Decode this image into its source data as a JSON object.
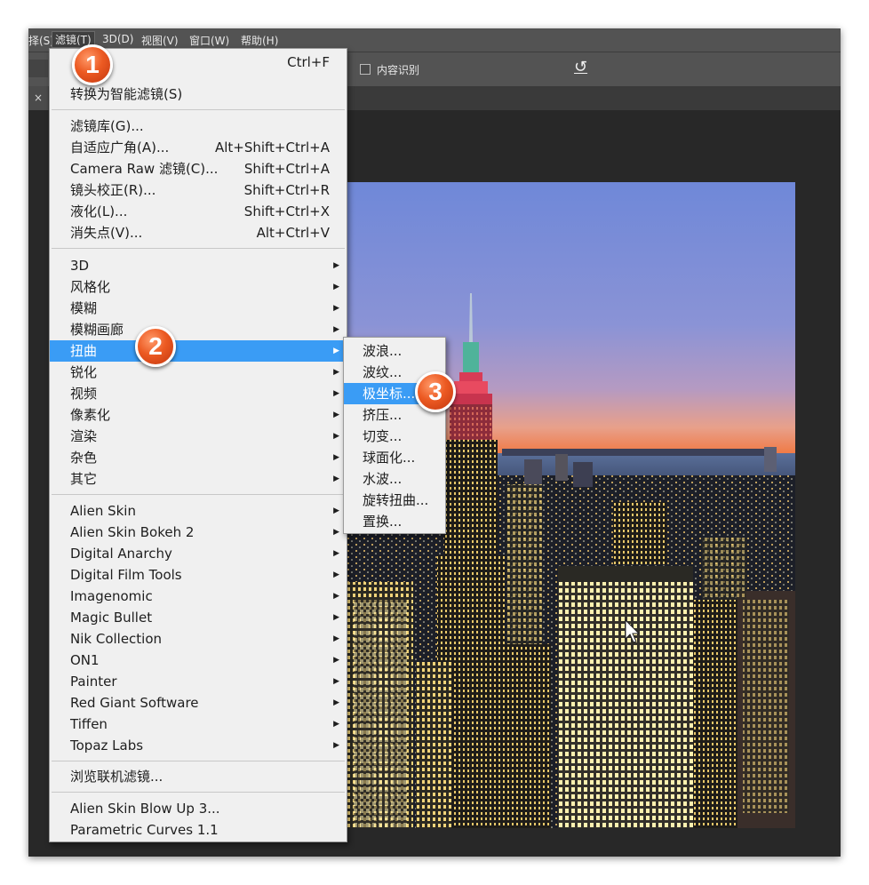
{
  "menubar": {
    "items": [
      {
        "label": "择(S)"
      },
      {
        "label": "滤镜(T)"
      },
      {
        "label": "3D(D)"
      },
      {
        "label": "视图(V)"
      },
      {
        "label": "窗口(W)"
      },
      {
        "label": "帮助(H)"
      }
    ]
  },
  "options_bar": {
    "content_aware_label": "内容识别",
    "undo_glyph": "↺"
  },
  "tab": {
    "close_glyph": "×"
  },
  "filter_menu": {
    "last_filter_shortcut": "Ctrl+F",
    "convert_smart": "转换为智能滤镜(S)",
    "filter_items": [
      {
        "label": "滤镜库(G)...",
        "shortcut": ""
      },
      {
        "label": "自适应广角(A)...",
        "shortcut": "Alt+Shift+Ctrl+A"
      },
      {
        "label": "Camera Raw 滤镜(C)...",
        "shortcut": "Shift+Ctrl+A"
      },
      {
        "label": "镜头校正(R)...",
        "shortcut": "Shift+Ctrl+R"
      },
      {
        "label": "液化(L)...",
        "shortcut": "Shift+Ctrl+X"
      },
      {
        "label": "消失点(V)...",
        "shortcut": "Alt+Ctrl+V"
      }
    ],
    "categories": [
      {
        "label": "3D"
      },
      {
        "label": "风格化"
      },
      {
        "label": "模糊"
      },
      {
        "label": "模糊画廊"
      },
      {
        "label": "扭曲"
      },
      {
        "label": "锐化"
      },
      {
        "label": "视频"
      },
      {
        "label": "像素化"
      },
      {
        "label": "渲染"
      },
      {
        "label": "杂色"
      },
      {
        "label": "其它"
      }
    ],
    "plugins": [
      {
        "label": "Alien Skin"
      },
      {
        "label": "Alien Skin Bokeh 2"
      },
      {
        "label": "Digital Anarchy"
      },
      {
        "label": "Digital Film Tools"
      },
      {
        "label": "Imagenomic"
      },
      {
        "label": "Magic Bullet"
      },
      {
        "label": "Nik Collection"
      },
      {
        "label": "ON1"
      },
      {
        "label": "Painter"
      },
      {
        "label": "Red Giant Software"
      },
      {
        "label": "Tiffen"
      },
      {
        "label": "Topaz Labs"
      }
    ],
    "browse_online": "浏览联机滤镜...",
    "extras": [
      {
        "label": "Alien Skin Blow Up 3..."
      },
      {
        "label": "Parametric Curves 1.1"
      }
    ]
  },
  "distort_submenu": {
    "items": [
      {
        "label": "波浪..."
      },
      {
        "label": "波纹..."
      },
      {
        "label": "极坐标..."
      },
      {
        "label": "挤压..."
      },
      {
        "label": "切变..."
      },
      {
        "label": "球面化..."
      },
      {
        "label": "水波..."
      },
      {
        "label": "旋转扭曲..."
      },
      {
        "label": "置换..."
      }
    ]
  },
  "badges": [
    "1",
    "2",
    "3"
  ],
  "arrow_glyph": "▶",
  "colors": {
    "menu_bg": "#f0f0f0",
    "highlight": "#3a9cf5",
    "app_chrome": "#535353",
    "canvas_bg": "#282828",
    "badge": "#e8531d"
  }
}
